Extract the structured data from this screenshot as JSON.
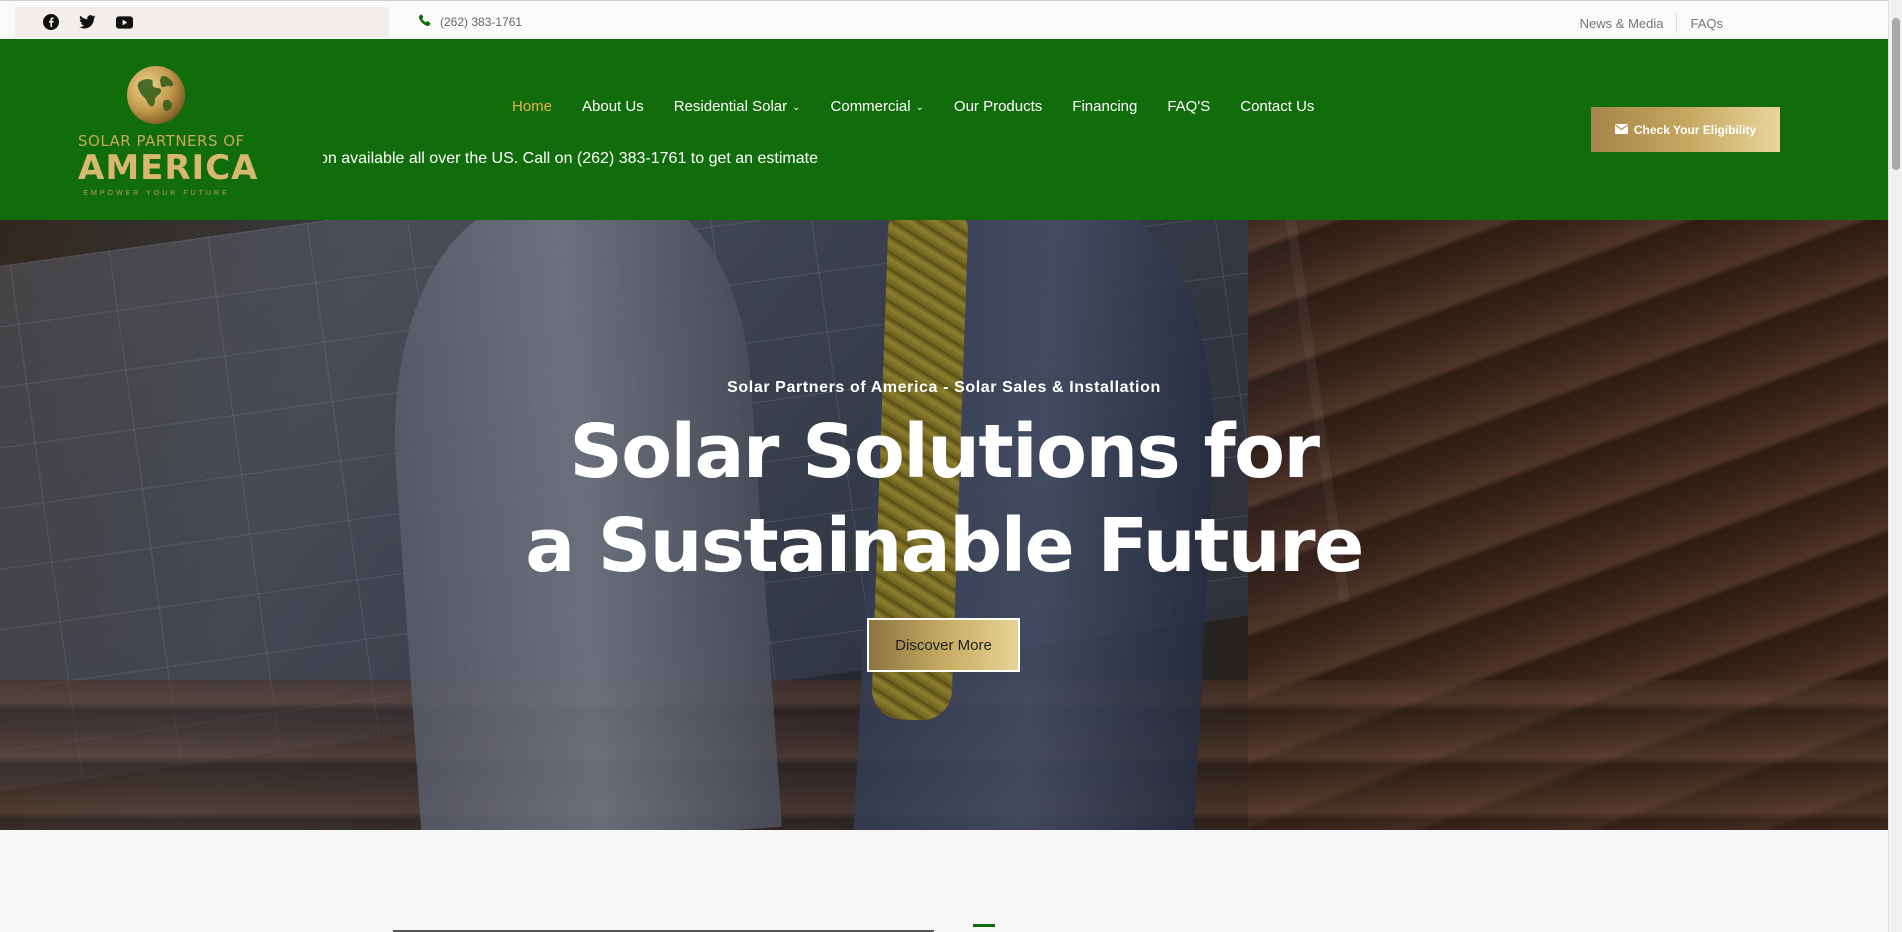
{
  "topbar": {
    "social": [
      "facebook-icon",
      "twitter-icon",
      "youtube-icon"
    ],
    "phone": "(262) 383-1761",
    "links": [
      "News & Media",
      "FAQs"
    ]
  },
  "logo": {
    "line1": "SOLAR PARTNERS OF",
    "line2": "AMERICA",
    "line3": "EMPOWER YOUR FUTURE"
  },
  "nav": {
    "items": [
      {
        "label": "Home",
        "active": true
      },
      {
        "label": "About Us"
      },
      {
        "label": "Residential Solar",
        "dropdown": true
      },
      {
        "label": "Commercial",
        "dropdown": true
      },
      {
        "label": "Our Products"
      },
      {
        "label": "Financing"
      },
      {
        "label": "FAQ'S"
      },
      {
        "label": "Contact Us"
      }
    ]
  },
  "marquee": "on available all over the US. Call on (262) 383-1761 to get an estimate",
  "cta": {
    "label": "Check Your Eligibility",
    "icon": "envelope-icon"
  },
  "hero": {
    "subtitle": "Solar Partners of America - Solar Sales & Installation",
    "title_line1": "Solar Solutions for",
    "title_line2": "a Sustainable Future",
    "button": "Discover More"
  },
  "colors": {
    "header_green": "#116d0c",
    "nav_active": "#e8b14a",
    "gold": "#c7ab62"
  }
}
